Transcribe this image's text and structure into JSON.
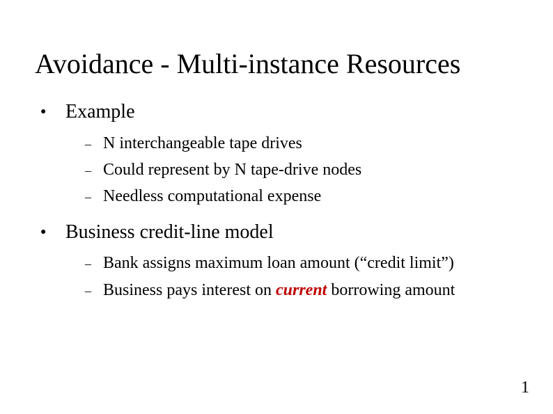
{
  "title": "Avoidance - Multi-instance Resources",
  "accent": "#c00000",
  "bullets": [
    {
      "label": "Example",
      "sub": [
        {
          "parts": [
            {
              "t": "N interchangeable tape drives"
            }
          ]
        },
        {
          "parts": [
            {
              "t": "Could represent by N tape-drive nodes"
            }
          ]
        },
        {
          "parts": [
            {
              "t": "Needless computational expense"
            }
          ]
        }
      ]
    },
    {
      "label": "Business credit-line model",
      "sub": [
        {
          "parts": [
            {
              "t": "Bank assigns maximum loan amount (“credit limit”)"
            }
          ]
        },
        {
          "parts": [
            {
              "t": "Business pays interest on "
            },
            {
              "t": "current",
              "hl": true
            },
            {
              "t": " borrowing amount"
            }
          ]
        }
      ]
    }
  ],
  "page_number": "1"
}
